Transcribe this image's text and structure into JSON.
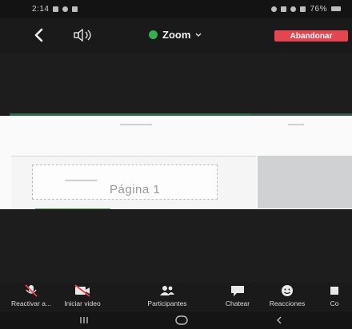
{
  "status_bar": {
    "time": "2:14",
    "battery": "76%"
  },
  "top_bar": {
    "meeting_title": "Zoom",
    "leave_label": "Abandonar"
  },
  "shared_screen": {
    "page_label": "Página 1"
  },
  "toolbar": {
    "items": [
      {
        "label": "Reactivar a...",
        "icon": "mic-muted-icon"
      },
      {
        "label": "Iniciar video",
        "icon": "video-off-icon"
      },
      {
        "label": "Participantes",
        "icon": "participants-icon"
      },
      {
        "label": "Chatear",
        "icon": "chat-icon"
      },
      {
        "label": "Reacciones",
        "icon": "reactions-icon"
      },
      {
        "label": "Co",
        "icon": "more-icon"
      }
    ]
  },
  "nav_bar": {
    "icons": [
      "recent-apps-icon",
      "home-icon",
      "back-nav-icon"
    ]
  },
  "colors": {
    "leave": "#e5454f",
    "shield": "#2fb34a",
    "background": "#1b1b1b"
  }
}
